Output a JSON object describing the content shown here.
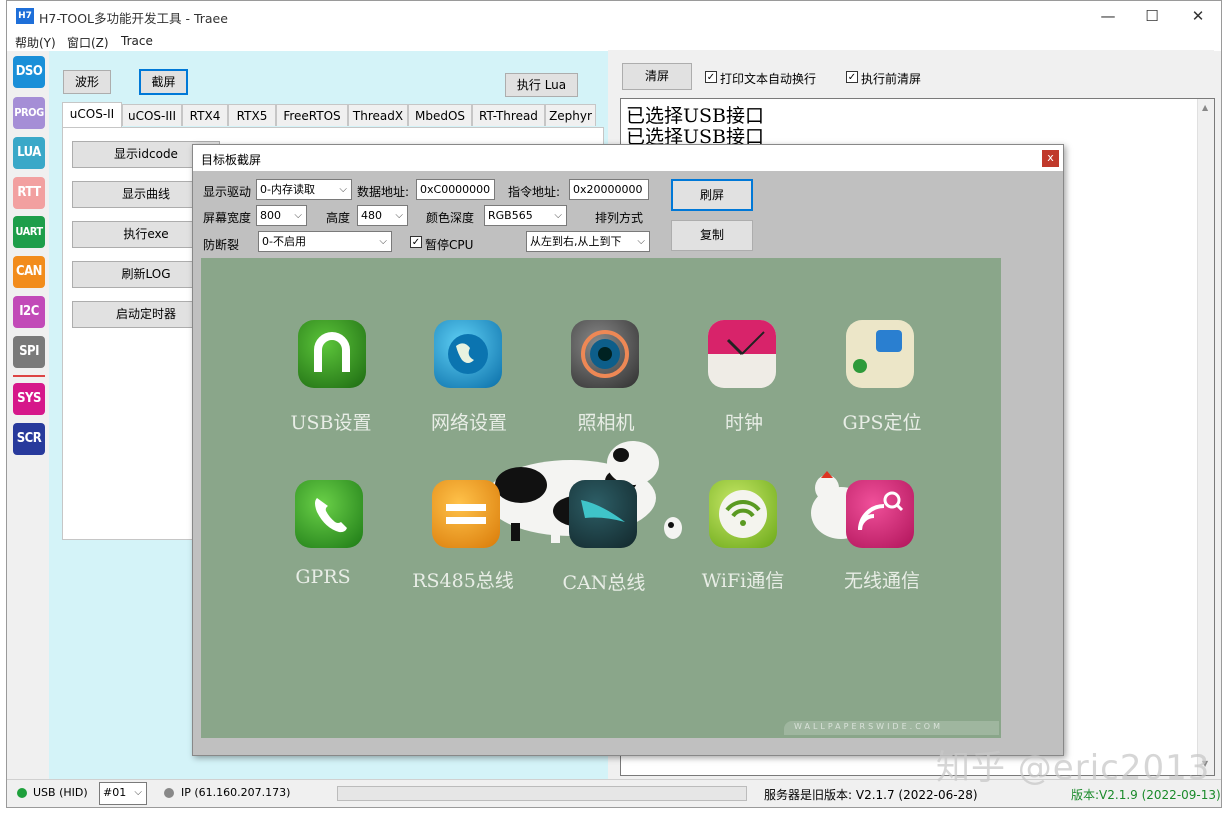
{
  "window": {
    "app_badge": "H7",
    "title": "H7-TOOL多功能开发工具 - Traee",
    "min": "—",
    "max": "☐",
    "close": "✕"
  },
  "menu": [
    "帮助(Y)",
    "窗口(Z)",
    "Trace"
  ],
  "sidebar": [
    {
      "label": "DSO",
      "color": "#1a8fd8"
    },
    {
      "label": "PROG",
      "color": "#a58ed6"
    },
    {
      "label": "LUA",
      "color": "#3aa8c8"
    },
    {
      "label": "RTT",
      "color": "#f2a0a0"
    },
    {
      "label": "UART",
      "color": "#1e9e4a"
    },
    {
      "label": "CAN",
      "color": "#f28c1c"
    },
    {
      "label": "I2C",
      "color": "#c24ab8"
    },
    {
      "label": "SPI",
      "color": "#7a7a7a"
    },
    {
      "label": "SYS",
      "color": "#d6178a"
    },
    {
      "label": "SCR",
      "color": "#283a9c"
    }
  ],
  "left": {
    "btn_wave": "波形",
    "btn_screenshot": "截屏",
    "btn_run_lua": "执行 Lua",
    "tabs": [
      "uCOS-II",
      "uCOS-III",
      "RTX4",
      "RTX5",
      "FreeRTOS",
      "ThreadX",
      "MbedOS",
      "RT-Thread",
      "Zephyr"
    ],
    "actions": [
      "显示idcode",
      "显示曲线",
      "执行exe",
      "刷新LOG",
      "启动定时器"
    ]
  },
  "right": {
    "btn_clear": "清屏",
    "chk_wrap": "打印文本自动换行",
    "chk_clear_before": "执行前清屏",
    "log": [
      "已选择USB接口",
      "已选择USB接口"
    ]
  },
  "dialog": {
    "title": "目标板截屏",
    "close": "x",
    "driver_label": "显示驱动",
    "driver_value": "0-内存读取",
    "data_addr_label": "数据地址:",
    "data_addr_value": "0xC0000000",
    "cmd_addr_label": "指令地址:",
    "cmd_addr_value": "0x20000000",
    "width_label": "屏幕宽度",
    "width_value": "800",
    "height_label": "高度",
    "height_value": "480",
    "depth_label": "颜色深度",
    "depth_value": "RGB565",
    "order_label": "排列方式",
    "order_value": "从左到右,从上到下",
    "antitear_label": "防断裂",
    "antitear_value": "0-不启用",
    "pause_cpu_label": "暂停CPU",
    "btn_refresh": "刷屏",
    "btn_copy": "复制",
    "screen": {
      "row1": [
        "USB设置",
        "网络设置",
        "照相机",
        "时钟",
        "GPS定位"
      ],
      "row2": [
        "GPRS",
        "RS485总线",
        "CAN总线",
        "WiFi通信",
        "无线通信"
      ],
      "credit": "WALLPAPERSWIDE.COM"
    }
  },
  "status": {
    "usb": "USB (HID)",
    "port": "#01",
    "ip": "IP (61.160.207.173)",
    "server": "服务器是旧版本: V2.1.7 (2022-06-28)",
    "version": "版本:V2.1.9 (2022-09-13)"
  },
  "watermark": "知乎 @eric2013"
}
